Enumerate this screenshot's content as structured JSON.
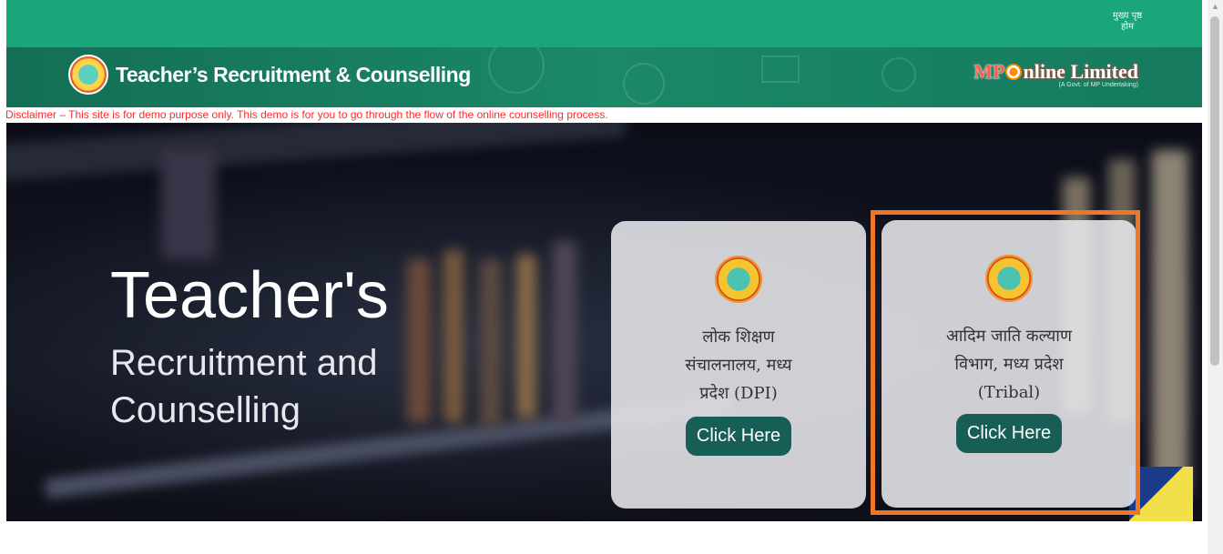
{
  "topbar": {
    "home_link": "मुख्य पृष्ठ\nहोम"
  },
  "header": {
    "title": "Teacher’s Recruitment & Counselling",
    "partner_logo": {
      "name_prefix": "MP",
      "name_suffix": "nline Limited",
      "tagline": "(A Govt. of MP Undertaking)"
    }
  },
  "disclaimer": "Disclaimer – This site is for demo purpose only. This demo is for you to go through the flow of the online counselling process.",
  "hero": {
    "title": "Teacher's",
    "subtitle_line1": "Recruitment and",
    "subtitle_line2": "Counselling"
  },
  "cards": [
    {
      "line1": "लोक शिक्षण",
      "line2": "संचालनालय, मध्य",
      "line3": "प्रदेश (DPI)",
      "button": "Click Here"
    },
    {
      "line1": "आदिम जाति कल्याण",
      "line2": "विभाग, मध्य प्रदेश",
      "line3": "(Tribal)",
      "button": "Click Here"
    }
  ],
  "colors": {
    "topbar": "#1aa57a",
    "header": "#136e55",
    "button": "#175e56",
    "highlight": "#ee7627",
    "disclaimer": "#ff2a2a"
  }
}
